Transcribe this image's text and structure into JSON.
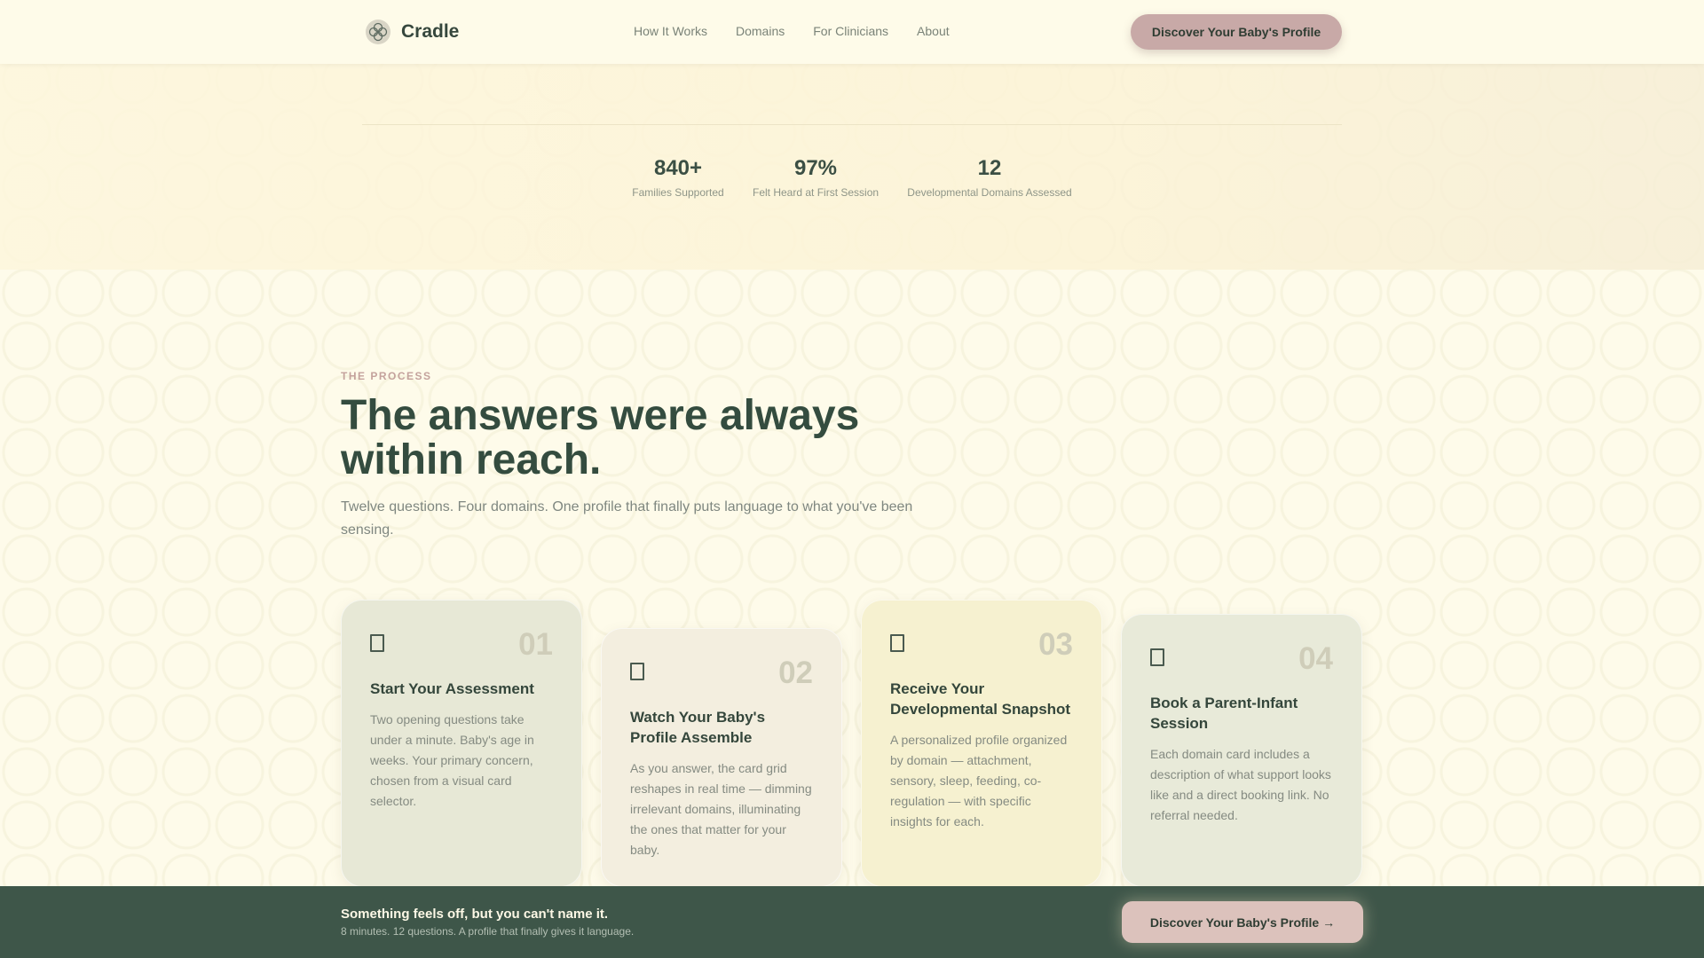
{
  "brand": {
    "name": "Cradle",
    "logo_icon": "flower-icon"
  },
  "nav": {
    "items": [
      {
        "label": "How It Works"
      },
      {
        "label": "Domains"
      },
      {
        "label": "For Clinicians"
      },
      {
        "label": "About"
      }
    ],
    "cta_label": "Discover Your Baby's Profile"
  },
  "stats": [
    {
      "value": "840+",
      "label": "Families Supported"
    },
    {
      "value": "97%",
      "label": "Felt Heard at First Session"
    },
    {
      "value": "12",
      "label": "Developmental Domains Assessed"
    }
  ],
  "process": {
    "eyebrow": "THE PROCESS",
    "heading": "The answers were always within reach.",
    "subheading": "Twelve questions. Four domains. One profile that finally puts language to what you've been sensing."
  },
  "steps": [
    {
      "number": "01",
      "title": "Start Your Assessment",
      "text": "Two opening questions take under a minute. Baby's age in weeks. Your primary concern, chosen from a visual card selector.",
      "icon": "document-icon",
      "color": "#e7e8d6"
    },
    {
      "number": "02",
      "title": "Watch Your Baby's Profile Assemble",
      "text": "As you answer, the card grid reshapes in real time — dimming irrelevant domains, illuminating the ones that matter for your baby.",
      "icon": "document-icon",
      "color": "#f3eedf"
    },
    {
      "number": "03",
      "title": "Receive Your Developmental Snapshot",
      "text": "A personalized profile organized by domain — attachment, sensory, sleep, feeding, co-regulation — with specific insights for each.",
      "icon": "document-icon",
      "color": "#f6f1d0"
    },
    {
      "number": "04",
      "title": "Book a Parent-Infant Session",
      "text": "Each domain card includes a description of what support looks like and a direct booking link. No referral needed.",
      "icon": "document-icon",
      "color": "#e8ead9"
    }
  ],
  "bottom_bar": {
    "title": "Something feels off, but you can't name it.",
    "subtitle": "8 minutes. 12 questions. A profile that finally gives it language.",
    "cta_label": "Discover Your Baby's Profile →"
  }
}
